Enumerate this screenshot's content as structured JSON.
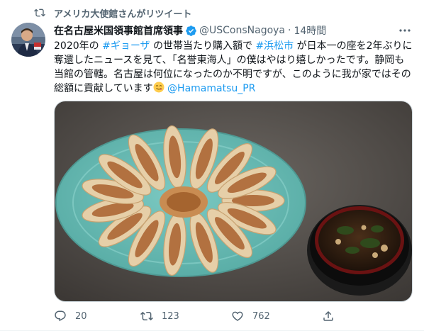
{
  "retweet": {
    "text": "アメリカ大使館さんがリツイート"
  },
  "author": {
    "name": "在名古屋米国領事館首席領事",
    "handle": "@USConsNagoya",
    "separator": "·",
    "time": "14時間"
  },
  "tweet": {
    "t1": "2020年の ",
    "tag1": "#ギョーザ",
    "t2": " の世帯当たり購入額で ",
    "tag2": "#浜松市",
    "t3": " が日本一の座を2年ぶりに奪還したニュースを見て、「名誉東海人」の僕はやはり嬉しかったです。静岡も当館の管轄。名古屋は何位になったのか不明ですが、このように我が家ではその総額に貢献しています",
    "mention": "@Hamamatsu_PR"
  },
  "stats": {
    "replies": "20",
    "retweets": "123",
    "likes": "762"
  },
  "icons": {
    "retweet_indicator": "retweet-icon",
    "verified": "verified-badge-icon",
    "more": "more-options-icon",
    "reply": "reply-icon",
    "retweet": "retweet-icon",
    "like": "heart-icon",
    "share": "share-icon",
    "emoji": "yummy-face-emoji"
  },
  "colors": {
    "link": "#1d9bf0",
    "secondary": "#536471",
    "verified": "#1d9bf0"
  }
}
